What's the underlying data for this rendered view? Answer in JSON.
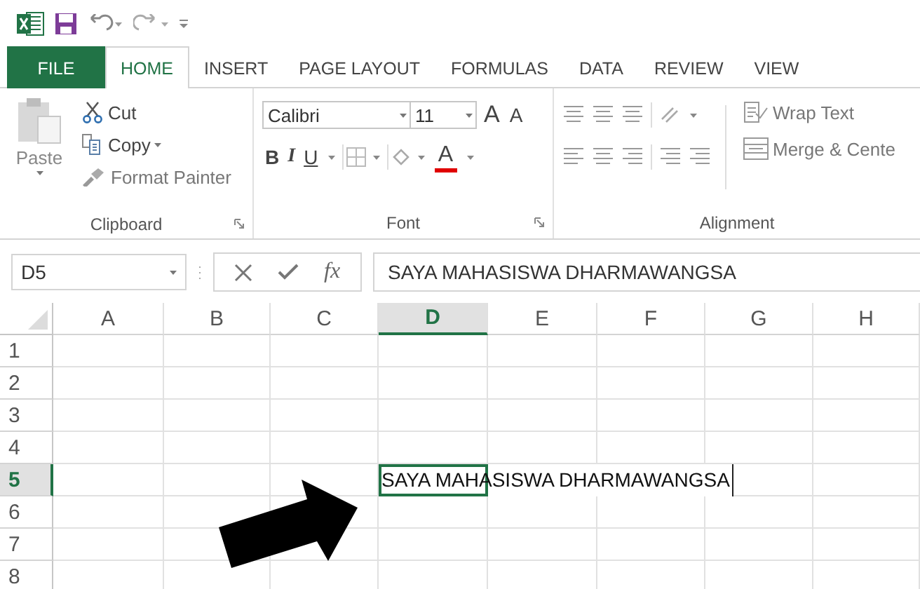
{
  "tabs": [
    {
      "label": "FILE",
      "kind": "file",
      "selected": false
    },
    {
      "label": "HOME",
      "kind": "tab",
      "selected": true
    },
    {
      "label": "INSERT",
      "kind": "tab",
      "selected": false
    },
    {
      "label": "PAGE LAYOUT",
      "kind": "tab",
      "selected": false
    },
    {
      "label": "FORMULAS",
      "kind": "tab",
      "selected": false
    },
    {
      "label": "DATA",
      "kind": "tab",
      "selected": false
    },
    {
      "label": "REVIEW",
      "kind": "tab",
      "selected": false
    },
    {
      "label": "VIEW",
      "kind": "tab",
      "selected": false
    }
  ],
  "ribbon": {
    "clipboard": {
      "paste": "Paste",
      "cut": "Cut",
      "copy": "Copy",
      "format_painter": "Format Painter",
      "label": "Clipboard"
    },
    "font": {
      "font_name": "Calibri",
      "font_size": "11",
      "grow_font": "A",
      "shrink_font": "A",
      "bold": "B",
      "italic": "I",
      "underline": "U",
      "font_color": "A",
      "label": "Font"
    },
    "alignment": {
      "wrap_text": "Wrap Text",
      "merge": "Merge & Cente",
      "label": "Alignment"
    }
  },
  "formula_bar": {
    "name_box": "D5",
    "insert_function": "fx",
    "content": "SAYA MAHASISWA DHARMAWANGSA"
  },
  "sheet": {
    "columns": [
      {
        "label": "A",
        "selected": false
      },
      {
        "label": "B",
        "selected": false
      },
      {
        "label": "C",
        "selected": false
      },
      {
        "label": "D",
        "selected": true
      },
      {
        "label": "E",
        "selected": false
      },
      {
        "label": "F",
        "selected": false
      },
      {
        "label": "G",
        "selected": false
      },
      {
        "label": "H",
        "selected": false
      }
    ],
    "rows": [
      {
        "label": "1",
        "selected": false
      },
      {
        "label": "2",
        "selected": false
      },
      {
        "label": "3",
        "selected": false
      },
      {
        "label": "4",
        "selected": false
      },
      {
        "label": "5",
        "selected": true,
        "entry": "SAYA MAHASISWA DHARMAWANGSA"
      },
      {
        "label": "6",
        "selected": false
      },
      {
        "label": "7",
        "selected": false
      },
      {
        "label": "8",
        "selected": false
      }
    ]
  }
}
